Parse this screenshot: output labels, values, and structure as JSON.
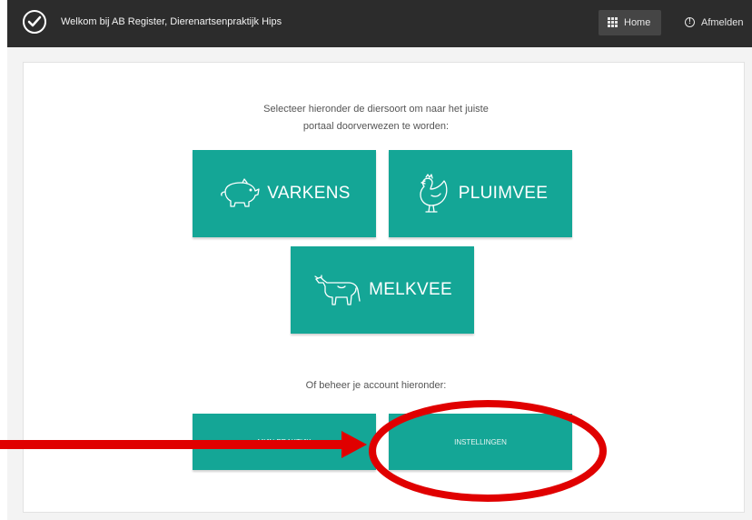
{
  "topbar": {
    "welcome": "Welkom bij AB Register, Dierenartsenpraktijk Hips",
    "home_label": "Home",
    "logout_label": "Afmelden"
  },
  "intro": {
    "line1": "Selecteer hieronder de diersoort om naar het juiste",
    "line2": "portaal doorverwezen te worden:"
  },
  "tiles": {
    "varkens": "VARKENS",
    "pluimvee": "PLUIMVEE",
    "melkvee": "MELKVEE"
  },
  "manage": {
    "text": "Of beheer je account hieronder:",
    "mijn_praktijk": "MIJN PRAKTIJK",
    "instellingen": "INSTELLINGEN"
  },
  "colors": {
    "accent": "#14a696",
    "topbar": "#2c2c2c",
    "annotation": "#e00000"
  },
  "icons": {
    "logo": "check-circle-icon",
    "home": "grid-icon",
    "logout": "info-icon",
    "varkens": "pig-icon",
    "pluimvee": "chicken-icon",
    "melkvee": "cow-icon"
  }
}
